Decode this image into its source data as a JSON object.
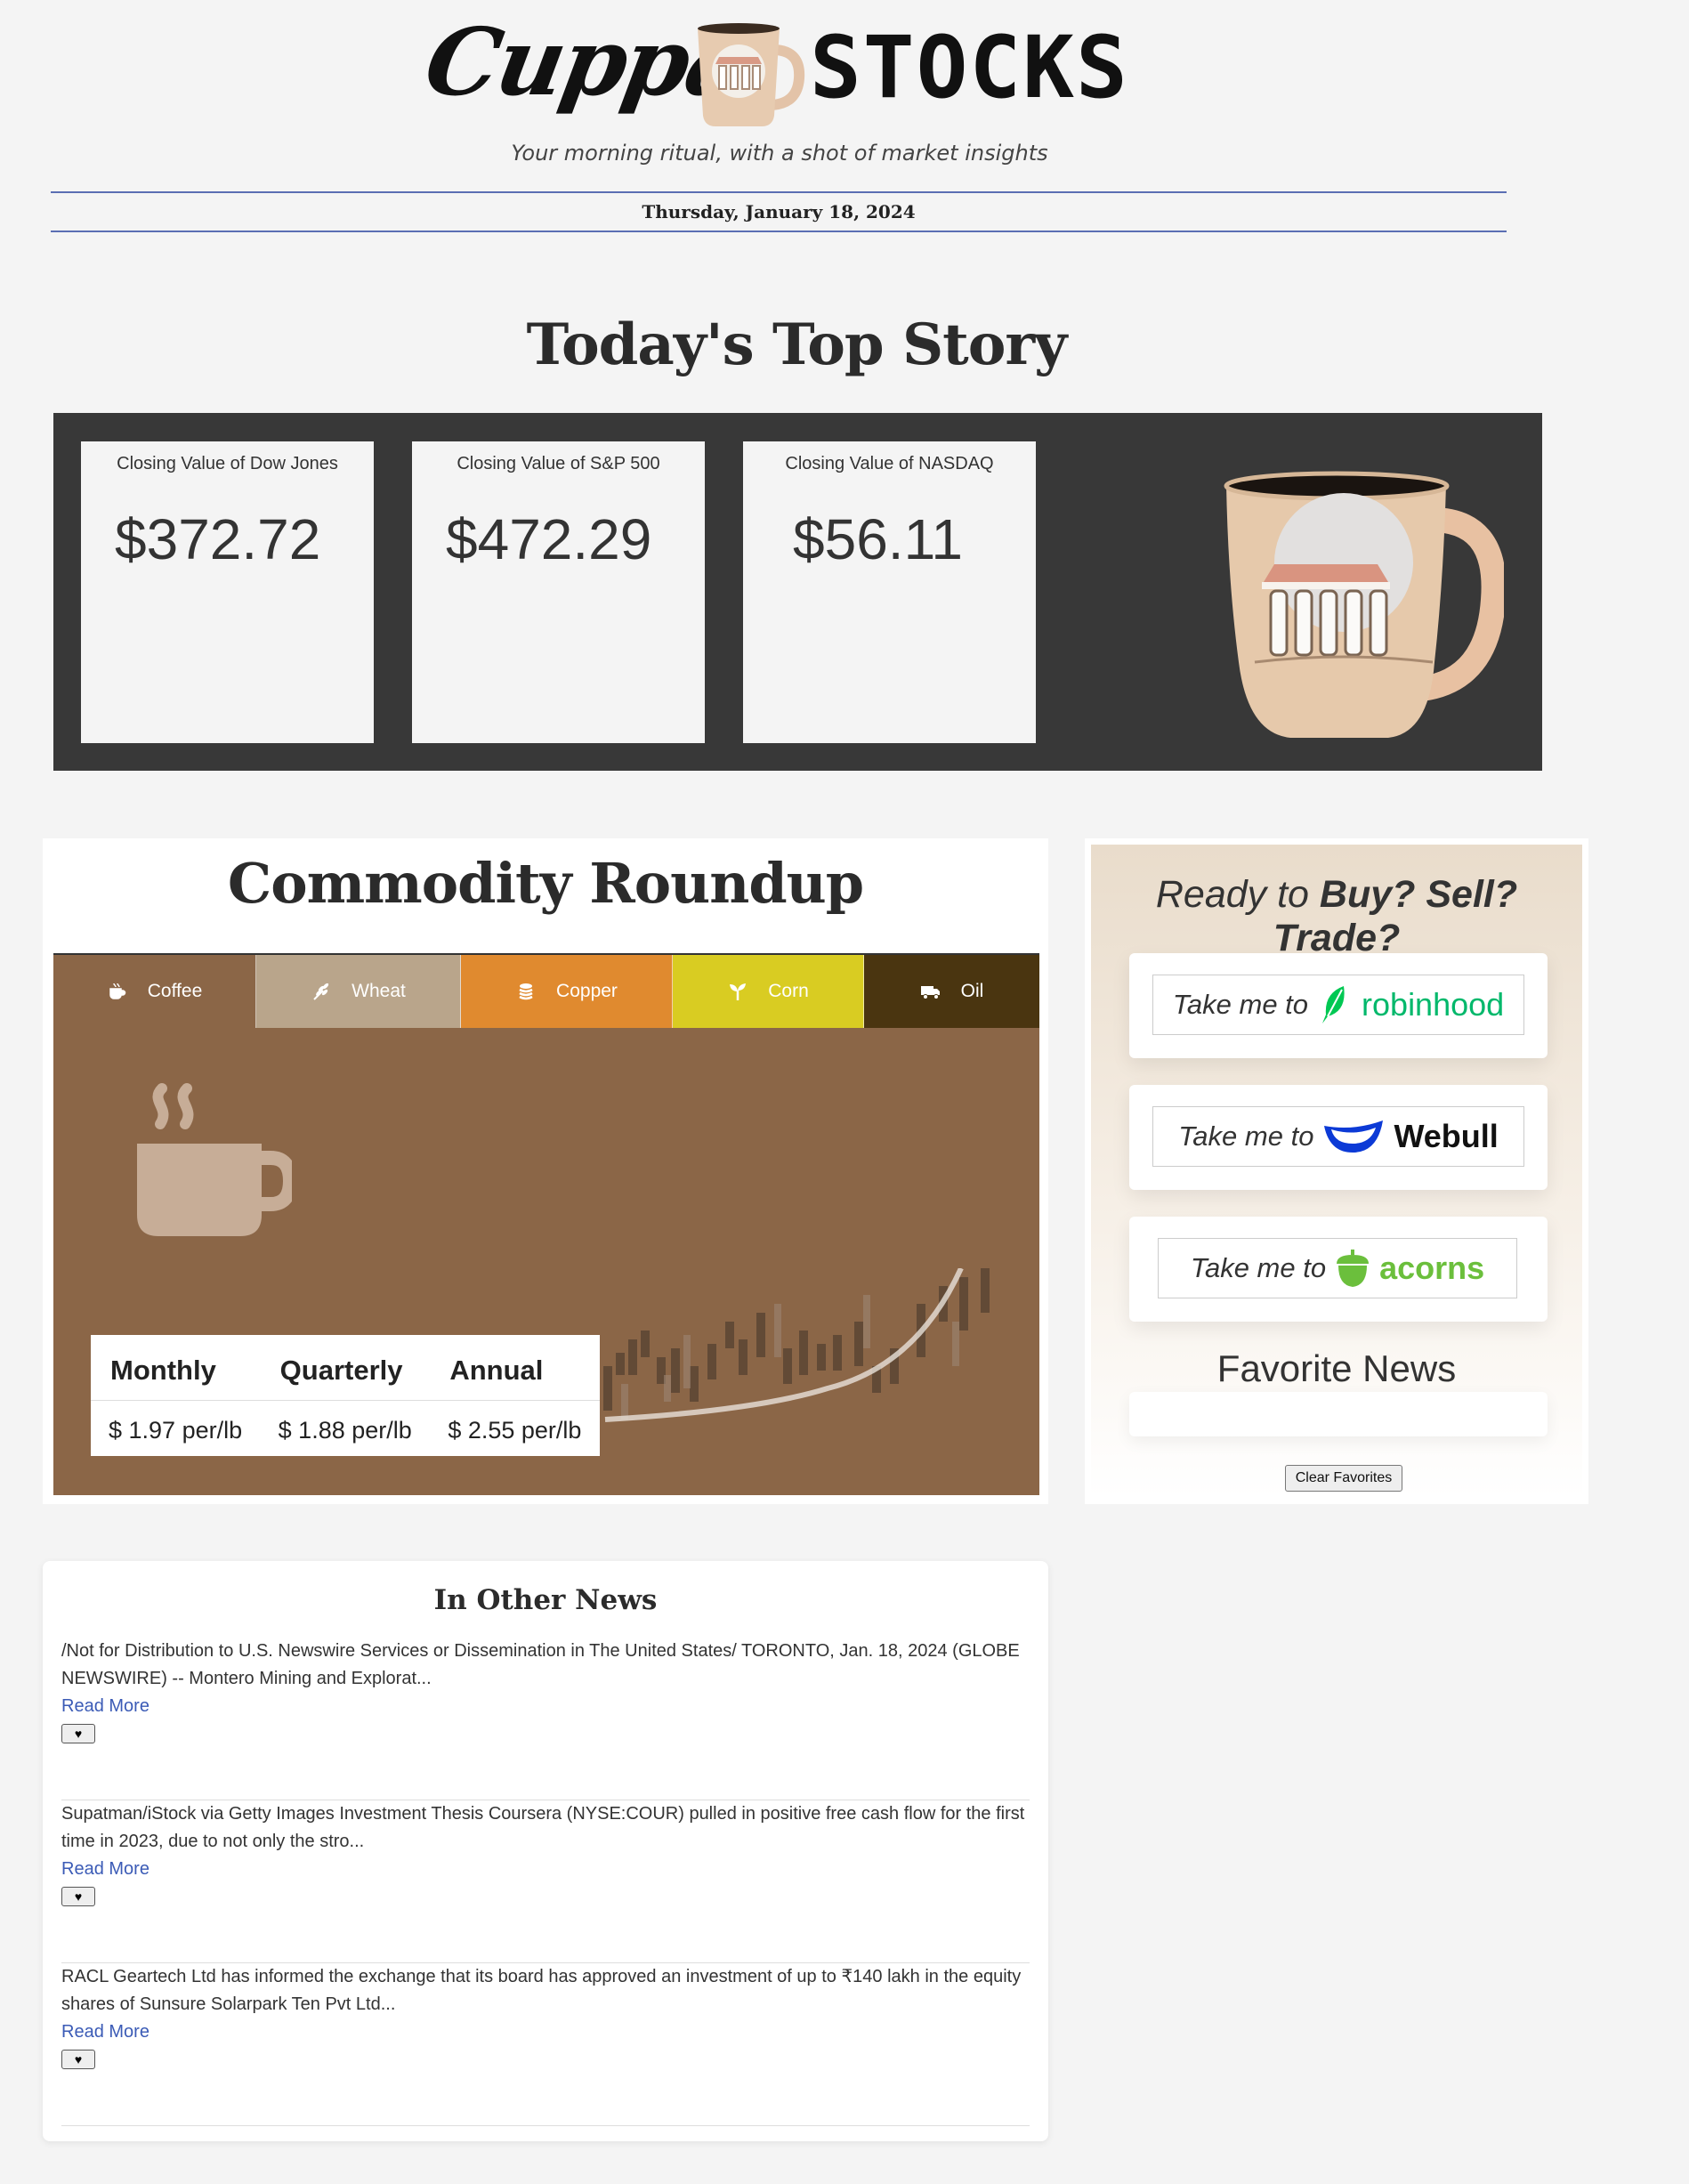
{
  "header": {
    "brand_script": "Cuppa",
    "brand_block": "STOCKS",
    "tagline": "Your morning ritual, with a shot of market insights",
    "date": "Thursday, January 18, 2024"
  },
  "top_story": {
    "title": "Today's Top Story",
    "indices": [
      {
        "label": "Closing Value of Dow Jones",
        "value": "$372.72"
      },
      {
        "label": "Closing Value of S&P 500",
        "value": "$472.29"
      },
      {
        "label": "Closing Value of NASDAQ",
        "value": "$56.11"
      }
    ]
  },
  "commodity": {
    "title": "Commodity Roundup",
    "tabs": [
      {
        "label": "Coffee",
        "icon": "mug-icon",
        "color": "#8b6647"
      },
      {
        "label": "Wheat",
        "icon": "wheat-icon",
        "color": "#b9a58b"
      },
      {
        "label": "Copper",
        "icon": "coins-icon",
        "color": "#e08a2f"
      },
      {
        "label": "Corn",
        "icon": "seedling-icon",
        "color": "#d9cc22"
      },
      {
        "label": "Oil",
        "icon": "truck-icon",
        "color": "#4a3510"
      }
    ],
    "selected": "Coffee",
    "table": {
      "headers": [
        "Monthly",
        "Quarterly",
        "Annual"
      ],
      "values": [
        "$ 1.97 per/lb",
        "$ 1.88 per/lb",
        "$ 2.55 per/lb"
      ]
    }
  },
  "sidebar": {
    "headline_plain": "Ready to",
    "headline_bold": "Buy? Sell? Trade?",
    "take_me_to": "Take me to",
    "brokers": [
      {
        "name": "robinhood",
        "color": "#00c805"
      },
      {
        "name": "Webull",
        "color": "#111111"
      },
      {
        "name": "acorns",
        "color": "#6bbf3c"
      }
    ],
    "favorites_title": "Favorite News",
    "clear_label": "Clear Favorites"
  },
  "news": {
    "title": "In Other News",
    "read_more": "Read More",
    "heart": "♥",
    "items": [
      {
        "text": "/Not for Distribution to U.S. Newswire Services or Dissemination in The United States/ TORONTO, Jan. 18, 2024 (GLOBE NEWSWIRE) -- Montero Mining and Explorat..."
      },
      {
        "text": "Supatman/iStock via Getty Images Investment Thesis Coursera (NYSE:COUR) pulled in positive free cash flow for the first time in 2023, due to not only the stro..."
      },
      {
        "text": "RACL Geartech Ltd has informed the exchange that its board has approved an investment of up to ₹140 lakh in the equity shares of Sunsure Solarpark Ten Pvt Ltd..."
      }
    ]
  }
}
